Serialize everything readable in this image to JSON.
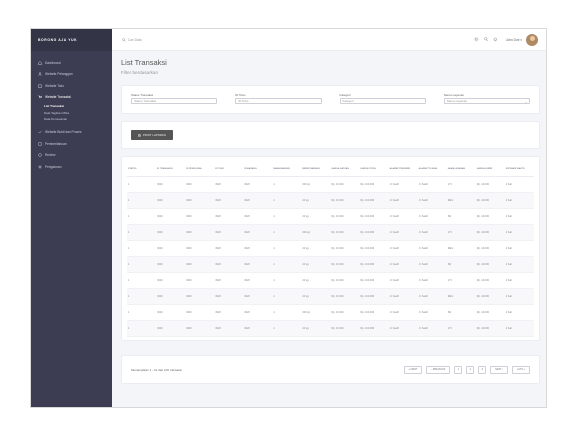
{
  "brand": "BORONG AJA YUK",
  "sidebar": {
    "items": [
      {
        "label": "Dashboard",
        "icon": "home-icon"
      },
      {
        "label": "Website Pelanggan",
        "icon": "users-icon"
      },
      {
        "label": "Website Toko",
        "icon": "store-icon"
      },
      {
        "label": "Website Transaksi",
        "icon": "cart-icon"
      },
      {
        "label": "Website Bukti dan Proses",
        "icon": "check-icon"
      },
      {
        "label": "Pemberitahuan",
        "icon": "bell-icon"
      },
      {
        "label": "Review",
        "icon": "star-icon"
      },
      {
        "label": "Pengaturan",
        "icon": "gear-icon"
      }
    ],
    "subitems": [
      {
        "label": "List Transaksi"
      },
      {
        "label": "Data Tagihan Mitra"
      },
      {
        "label": "Data Pemesanan"
      }
    ]
  },
  "topbar": {
    "search_placeholder": "Cari Data",
    "user_name": "John Doe ▾"
  },
  "page": {
    "title": "List Transaksi",
    "subtitle": "Filter berdasarkan"
  },
  "filters": [
    {
      "label": "Status Transaksi",
      "value": "Status Transaksi"
    },
    {
      "label": "ID Toko",
      "value": "ID Toko"
    },
    {
      "label": "Kategori",
      "value": "Kategori"
    },
    {
      "label": "Nama Layanan",
      "value": "Nama Layanan"
    }
  ],
  "actions": {
    "print_label": "PRINT LAPORAN"
  },
  "table": {
    "columns": [
      "STATUS",
      "ID TRANSAKSI",
      "ID PENGGUNA",
      "ID TOKO",
      "ID BARANG",
      "NAMA BARANG",
      "BERAT BARANG",
      "HARGA SATUAN",
      "HARGA TOTAL",
      "ALAMAT PENGIRIM",
      "ALAMAT TUJUAN",
      "NAMA LAYANAN",
      "HARGA KURIR",
      "ESTIMASI WAKTU"
    ],
    "rows": [
      [
        "1",
        "3020",
        "3020",
        "3020",
        "3020",
        "1",
        "200 kg",
        "Rp. 10.000",
        "Rp. 100.000",
        "Jl. Kasih",
        "Jl. Kasih",
        "171",
        "Rp. 10.000",
        "2 hari"
      ],
      [
        "1",
        "3020",
        "3020",
        "3020",
        "3020",
        "1",
        "22 kg",
        "Rp. 10.000",
        "Rp. 100.000",
        "Jl. Kasih",
        "Jl. Kasih",
        "REG",
        "Rp. 10.000",
        "2 hari"
      ],
      [
        "1",
        "3020",
        "3020",
        "3020",
        "3020",
        "1",
        "22 kg",
        "Rp. 10.000",
        "Rp. 100.000",
        "Jl. Kasih",
        "Jl. Kasih",
        "SD",
        "Rp. 10.000",
        "2 hari"
      ],
      [
        "1",
        "3020",
        "3020",
        "3020",
        "3020",
        "1",
        "200 kg",
        "Rp. 10.000",
        "Rp. 100.000",
        "Jl. Kasih",
        "Jl. Kasih",
        "171",
        "Rp. 10.000",
        "2 hari"
      ],
      [
        "1",
        "3020",
        "3020",
        "3020",
        "3020",
        "1",
        "22 kg",
        "Rp. 10.000",
        "Rp. 100.000",
        "Jl. Kasih",
        "Jl. Kasih",
        "REG",
        "Rp. 10.000",
        "2 hari"
      ],
      [
        "1",
        "3020",
        "3020",
        "3020",
        "3020",
        "1",
        "22 kg",
        "Rp. 10.000",
        "Rp. 100.000",
        "Jl. Kasih",
        "Jl. Kasih",
        "SD",
        "Rp. 10.000",
        "2 hari"
      ],
      [
        "1",
        "3020",
        "3020",
        "3020",
        "3020",
        "1",
        "22 kg",
        "Rp. 10.000",
        "Rp. 100.000",
        "Jl. Kasih",
        "Jl. Kasih",
        "171",
        "Rp. 10.000",
        "2 hari"
      ],
      [
        "1",
        "3020",
        "3020",
        "3020",
        "3020",
        "1",
        "22 kg",
        "Rp. 10.000",
        "Rp. 100.000",
        "Jl. Kasih",
        "Jl. Kasih",
        "REG",
        "Rp. 10.000",
        "2 hari"
      ],
      [
        "1",
        "3020",
        "3020",
        "3020",
        "3020",
        "1",
        "200 kg",
        "Rp. 10.000",
        "Rp. 100.000",
        "Jl. Kasih",
        "Jl. Kasih",
        "SD",
        "Rp. 10.000",
        "2 hari"
      ],
      [
        "1",
        "3020",
        "3020",
        "3020",
        "3020",
        "1",
        "22 kg",
        "Rp. 10.000",
        "Rp. 100.000",
        "Jl. Kasih",
        "Jl. Kasih",
        "171",
        "Rp. 10.000",
        "2 hari"
      ]
    ]
  },
  "pagination": {
    "info": "Menampilkan 1 - 10 dari 100 transaksi",
    "first": "« FIRST",
    "prev": "‹ PREVIOUS",
    "pages": [
      "1",
      "2",
      "3"
    ],
    "next": "NEXT ›",
    "last": "LAST »"
  },
  "colors": {
    "sidebar": "#3c3d52",
    "brand_bar": "#333446",
    "page_bg": "#f4f5f9",
    "button": "#555555"
  }
}
